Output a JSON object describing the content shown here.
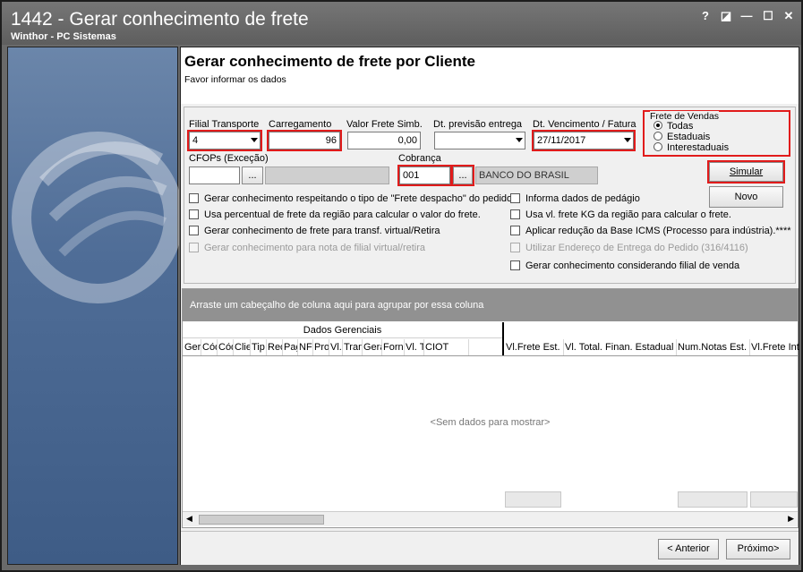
{
  "window": {
    "title": "1442 - Gerar conhecimento de frete",
    "subtitle": "Winthor - PC Sistemas",
    "controls": {
      "help": "?",
      "restore": "◪",
      "minimize": "—",
      "maximize": "☐",
      "close": "✕"
    }
  },
  "header": {
    "title": "Gerar conhecimento de frete por Cliente",
    "subtitle": "Favor informar os dados"
  },
  "form": {
    "filial_label": "Filial Transporte",
    "filial_value": "4",
    "carregamento_label": "Carregamento",
    "carregamento_value": "96",
    "valor_frete_label": "Valor Frete Simb.",
    "valor_frete_value": "0,00",
    "dt_previsao_label": "Dt. previsão entrega",
    "dt_previsao_value": "",
    "dt_vencimento_label": "Dt. Vencimento / Fatura",
    "dt_vencimento_value": "27/11/2017",
    "cfops_label": "CFOPs (Exceção)",
    "cfops_value": "",
    "cfops_button": "...",
    "cobranca_label": "Cobrança",
    "cobranca_value": "001",
    "cobranca_button": "...",
    "cobranca_desc": "BANCO DO BRASIL"
  },
  "frete_vendas": {
    "legend": "Frete de Vendas",
    "options": [
      "Todas",
      "Estaduais",
      "Interestaduais"
    ],
    "selected": "Todas"
  },
  "buttons": {
    "simular": "Simular",
    "novo": "Novo",
    "anterior": "< Anterior",
    "proximo": "Próximo>"
  },
  "checkboxes_left": [
    "Gerar conhecimento respeitando o tipo de \"Frete despacho\" do pedido.",
    "Usa percentual de frete da região para calcular o valor do frete.",
    "Gerar conhecimento de frete para transf. virtual/Retira",
    "Gerar conhecimento para nota de filial virtual/retira"
  ],
  "checkboxes_right": [
    "Informa dados de pedágio",
    "Usa vl. frete KG da região para calcular o frete.",
    "Aplicar redução da Base ICMS (Processo para indústria).****",
    "Utilizar Endereço de Entrega do Pedido (316/4116)",
    "Gerar conhecimento considerando filial de venda"
  ],
  "grid": {
    "group_hint": "Arraste um cabeçalho de coluna aqui para agrupar por essa coluna",
    "band": "Dados Gerenciais",
    "columns_left": [
      "Ger",
      "Cód",
      "Cód",
      "Clie",
      "Tip",
      "Rec",
      "Pag",
      "NF",
      "Pro",
      "Vl.",
      "Tran",
      "Gera",
      "Forn",
      "Vl. T",
      "CIOT"
    ],
    "columns_right": [
      "Vl.Frete Est.",
      "Vl. Total. Finan. Estadual",
      "Num.Notas Est.",
      "Vl.Frete Int"
    ],
    "empty": "<Sem dados para mostrar>"
  }
}
